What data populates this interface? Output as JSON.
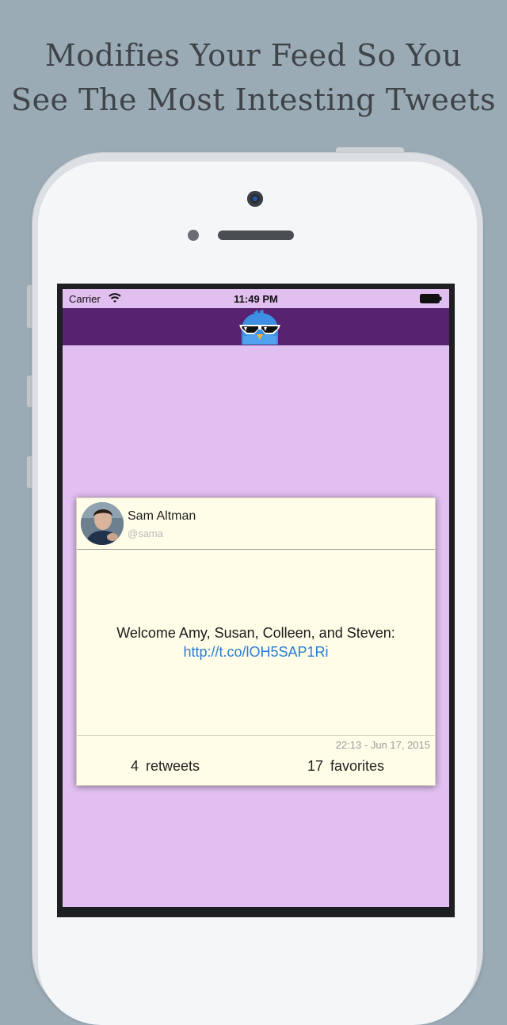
{
  "headline": {
    "line1": "Modifies Your Feed So You",
    "line2": "See The Most Intesting Tweets"
  },
  "status_bar": {
    "carrier": "Carrier",
    "time": "11:49 PM",
    "wifi_icon": "wifi-icon",
    "battery_icon": "battery-icon"
  },
  "nav": {
    "logo_icon": "cool-bird-with-sunglasses-icon"
  },
  "tweet": {
    "user_name": "Sam Altman",
    "user_handle": "@sama",
    "text": "Welcome Amy, Susan, Colleen, and Steven:",
    "link": "http://t.co/lOH5SAP1Ri",
    "timestamp": "22:13 - Jun 17, 2015",
    "retweets_count": "4",
    "retweets_label": "retweets",
    "favorites_count": "17",
    "favorites_label": "favorites"
  },
  "colors": {
    "background": "#9aabb6",
    "screen_background": "#e1bff0",
    "nav_bar": "#57226f",
    "card_background": "#fffde8",
    "link": "#2a7cd6"
  }
}
